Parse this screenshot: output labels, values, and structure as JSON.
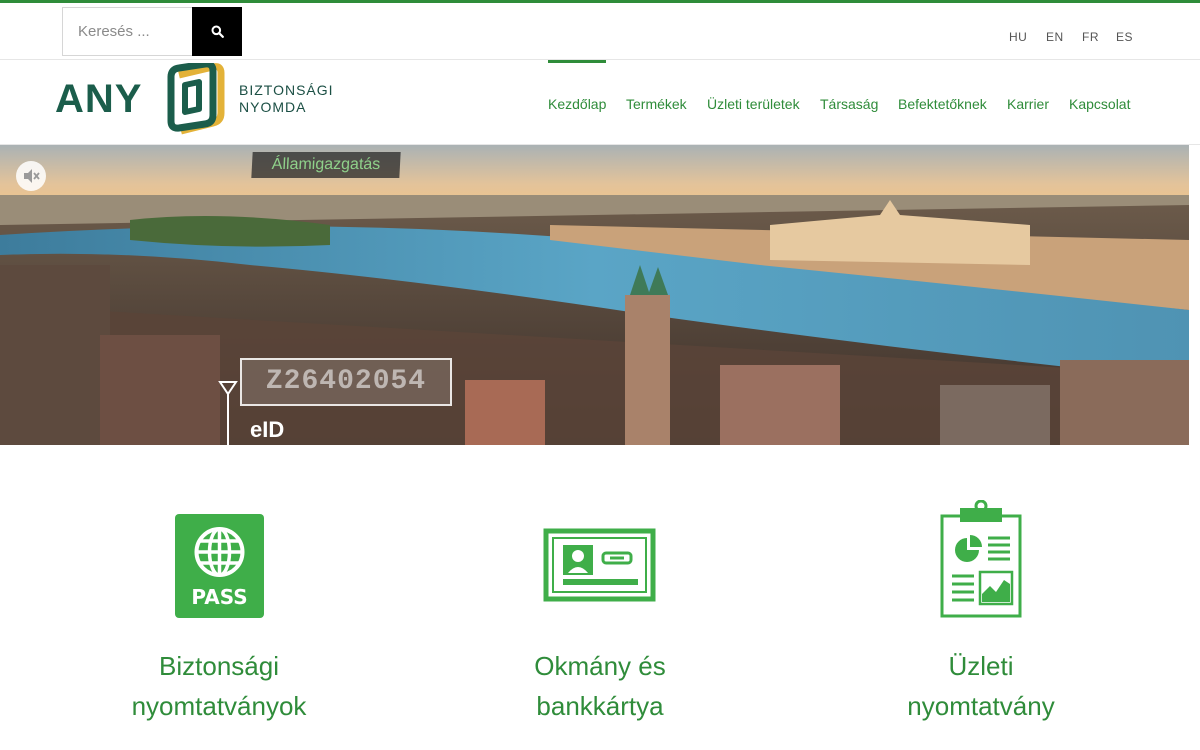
{
  "search": {
    "placeholder": "Keresés ..."
  },
  "languages": [
    "HU",
    "EN",
    "FR",
    "ES"
  ],
  "logo": {
    "wordmark": "ANY",
    "line1": "BIZTONSÁGI",
    "line2": "NYOMDA"
  },
  "nav": {
    "items": [
      {
        "label": "Kezdőlap",
        "active": true
      },
      {
        "label": "Termékek"
      },
      {
        "label": "Üzleti területek"
      },
      {
        "label": "Társaság"
      },
      {
        "label": "Befektetőknek"
      },
      {
        "label": "Karrier"
      },
      {
        "label": "Kapcsolat"
      }
    ]
  },
  "hero": {
    "tag": "Államigazgatás",
    "code": "Z26402054",
    "eid_label": "eID"
  },
  "features": [
    {
      "line1": "Biztonsági",
      "line2": "nyomtatványok",
      "icon": "passport-icon",
      "icon_label": "PASS"
    },
    {
      "line1": "Okmány és",
      "line2": "bankkártya",
      "icon": "id-card-icon"
    },
    {
      "line1": "Üzleti",
      "line2": "nyomtatvány",
      "icon": "clipboard-report-icon"
    }
  ],
  "colors": {
    "brand_green": "#2f8c3a",
    "icon_green": "#3fae49",
    "logo_dark": "#1b5d4b",
    "logo_gold": "#e3b238"
  }
}
